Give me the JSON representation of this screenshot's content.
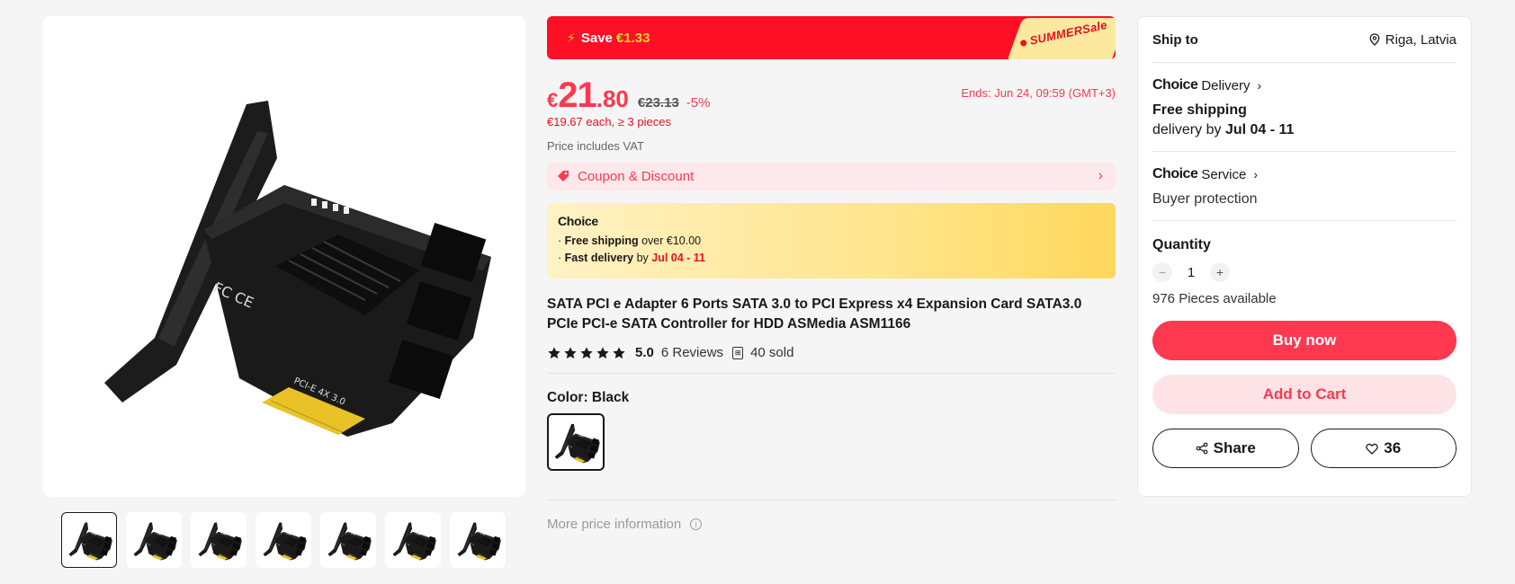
{
  "gallery": {
    "main_image_alt": "",
    "thumbnail_count": 7
  },
  "banner": {
    "save_label": "Save",
    "save_amount": "€1.33",
    "sale_tag": "SUMMERSale"
  },
  "price": {
    "currency": "€",
    "integer": "21",
    "decimal": ".80",
    "original": "€23.13",
    "discount": "-5%",
    "ends": "Ends: Jun 24, 09:59 (GMT+3)",
    "bulk": "€19.67 each, ≥ 3 pieces",
    "vat_note": "Price includes VAT"
  },
  "coupon": {
    "label": "Coupon & Discount"
  },
  "choice_box": {
    "header": "Choice",
    "line1_bold": "Free shipping",
    "line1_rest": "over €10.00",
    "line2_bold": "Fast delivery",
    "line2_mid": "by",
    "line2_date": "Jul 04 - 11"
  },
  "product": {
    "title": "SATA PCI e Adapter 6 Ports SATA 3.0 to PCI Express x4 Expansion Card SATA3.0 PCIe PCI-e SATA Controller for HDD ASMedia ASM1166",
    "rating": "5.0",
    "reviews": "6 Reviews",
    "sold": "40 sold",
    "color_label": "Color: Black",
    "more_price": "More price information"
  },
  "panel": {
    "ship_to_label": "Ship to",
    "location": "Riga, Latvia",
    "delivery_logo": "Choice",
    "delivery_label": "Delivery",
    "free_shipping": "Free shipping",
    "delivery_by": "delivery by",
    "delivery_date": "Jul 04 - 11",
    "service_logo": "Choice",
    "service_label": "Service",
    "buyer_protection": "Buyer protection",
    "quantity_label": "Quantity",
    "quantity_value": "1",
    "available": "976 Pieces available",
    "buy_now": "Buy now",
    "add_to_cart": "Add to Cart",
    "share": "Share",
    "wishlist_count": "36"
  },
  "colors": {
    "accent": "#fd384f",
    "banner_red": "#fd0f26",
    "gold": "#ffd23a"
  }
}
